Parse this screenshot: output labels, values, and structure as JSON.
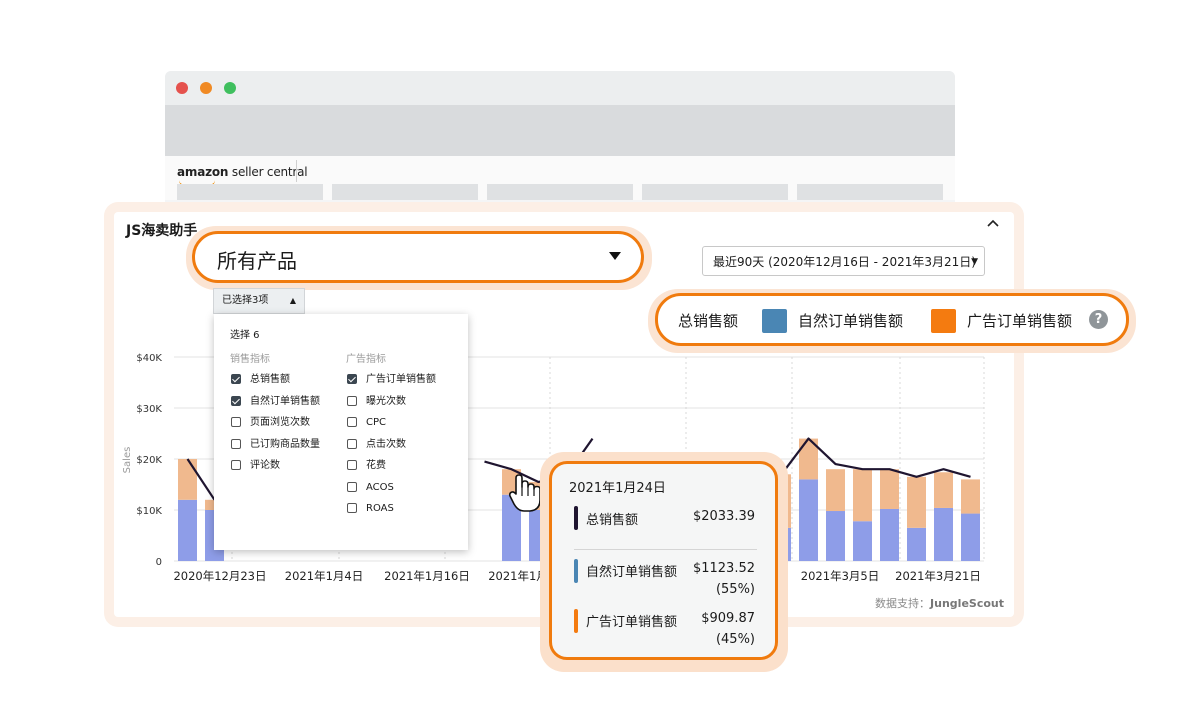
{
  "browser": {
    "dot_colors": [
      "#e5524d",
      "#f08a24",
      "#3fbf5e"
    ],
    "logo_bold": "amazon",
    "logo_rest": " seller central"
  },
  "app": {
    "title": "JS海卖助手",
    "collapse_icon": "chevron-up-icon",
    "date_range": "最近90天 (2020年12月16日 - 2021年3月21日)",
    "data_source_label": "数据支持：",
    "data_source_name": "JungleScout"
  },
  "product_select": {
    "value": "所有产品"
  },
  "metric_button": {
    "label": "已选择3项"
  },
  "metric_panel": {
    "title": "选择 6",
    "groups": [
      {
        "label": "销售指标",
        "items": [
          {
            "label": "总销售额",
            "checked": true
          },
          {
            "label": "自然订单销售额",
            "checked": true
          },
          {
            "label": "页面浏览次数",
            "checked": false
          },
          {
            "label": "已订购商品数量",
            "checked": false
          },
          {
            "label": "评论数",
            "checked": false
          }
        ]
      },
      {
        "label": "广告指标",
        "items": [
          {
            "label": "广告订单销售额",
            "checked": true
          },
          {
            "label": "曝光次数",
            "checked": false
          },
          {
            "label": "CPC",
            "checked": false
          },
          {
            "label": "点击次数",
            "checked": false
          },
          {
            "label": "花费",
            "checked": false
          },
          {
            "label": "ACOS",
            "checked": false
          },
          {
            "label": "ROAS",
            "checked": false
          }
        ]
      }
    ]
  },
  "legend": {
    "total": "总销售额",
    "organic": "自然订单销售额",
    "ads": "广告订单销售额",
    "help": "?",
    "organic_color": "#4a86b4",
    "ads_color": "#f47b10"
  },
  "tooltip": {
    "date": "2021年1月24日",
    "rows": [
      {
        "name": "总销售额",
        "value": "$2033.39",
        "pct": "",
        "color": "#1f1530"
      },
      {
        "name": "自然订单销售额",
        "value": "$1123.52",
        "pct": "(55%)",
        "color": "#4a86b4"
      },
      {
        "name": "广告订单销售额",
        "value": "$909.87",
        "pct": "(45%)",
        "color": "#f47b10"
      }
    ]
  },
  "chart_data": {
    "type": "bar",
    "ylabel": "Sales",
    "y_ticks": [
      "$40K",
      "$30K",
      "$20K",
      "$10K",
      "0"
    ],
    "ylim": [
      0,
      40000
    ],
    "x_tick_labels": [
      "2020年12月23日",
      "2021年1月4日",
      "2021年1月16日",
      "2021年1月",
      "2021年3月5日",
      "2021年3月21日"
    ],
    "grid": true,
    "series": [
      {
        "name": "自然订单销售额",
        "color": "#8e9de8",
        "values": [
          12000,
          10000,
          null,
          null,
          null,
          null,
          null,
          null,
          null,
          null,
          null,
          null,
          13000,
          10000,
          6500,
          null,
          null,
          null,
          null,
          null,
          null,
          null,
          6500,
          16000,
          9800,
          7800,
          10200,
          6500,
          10400,
          9300
        ]
      },
      {
        "name": "广告订单销售额",
        "color": "#f0b98e",
        "values": [
          8000,
          2000,
          null,
          null,
          null,
          null,
          null,
          null,
          null,
          null,
          null,
          null,
          5000,
          5500,
          10000,
          null,
          null,
          null,
          null,
          null,
          null,
          null,
          10500,
          8000,
          8200,
          10200,
          7800,
          10000,
          7000,
          6700
        ]
      },
      {
        "name": "总销售额",
        "color": "#1f1530",
        "values": [
          20000,
          12000,
          null,
          null,
          null,
          null,
          null,
          null,
          null,
          null,
          null,
          19500,
          18000,
          15500,
          16500,
          24000,
          null,
          null,
          null,
          null,
          null,
          null,
          17000,
          24000,
          19000,
          18000,
          18000,
          16500,
          18000,
          16500
        ]
      }
    ]
  }
}
